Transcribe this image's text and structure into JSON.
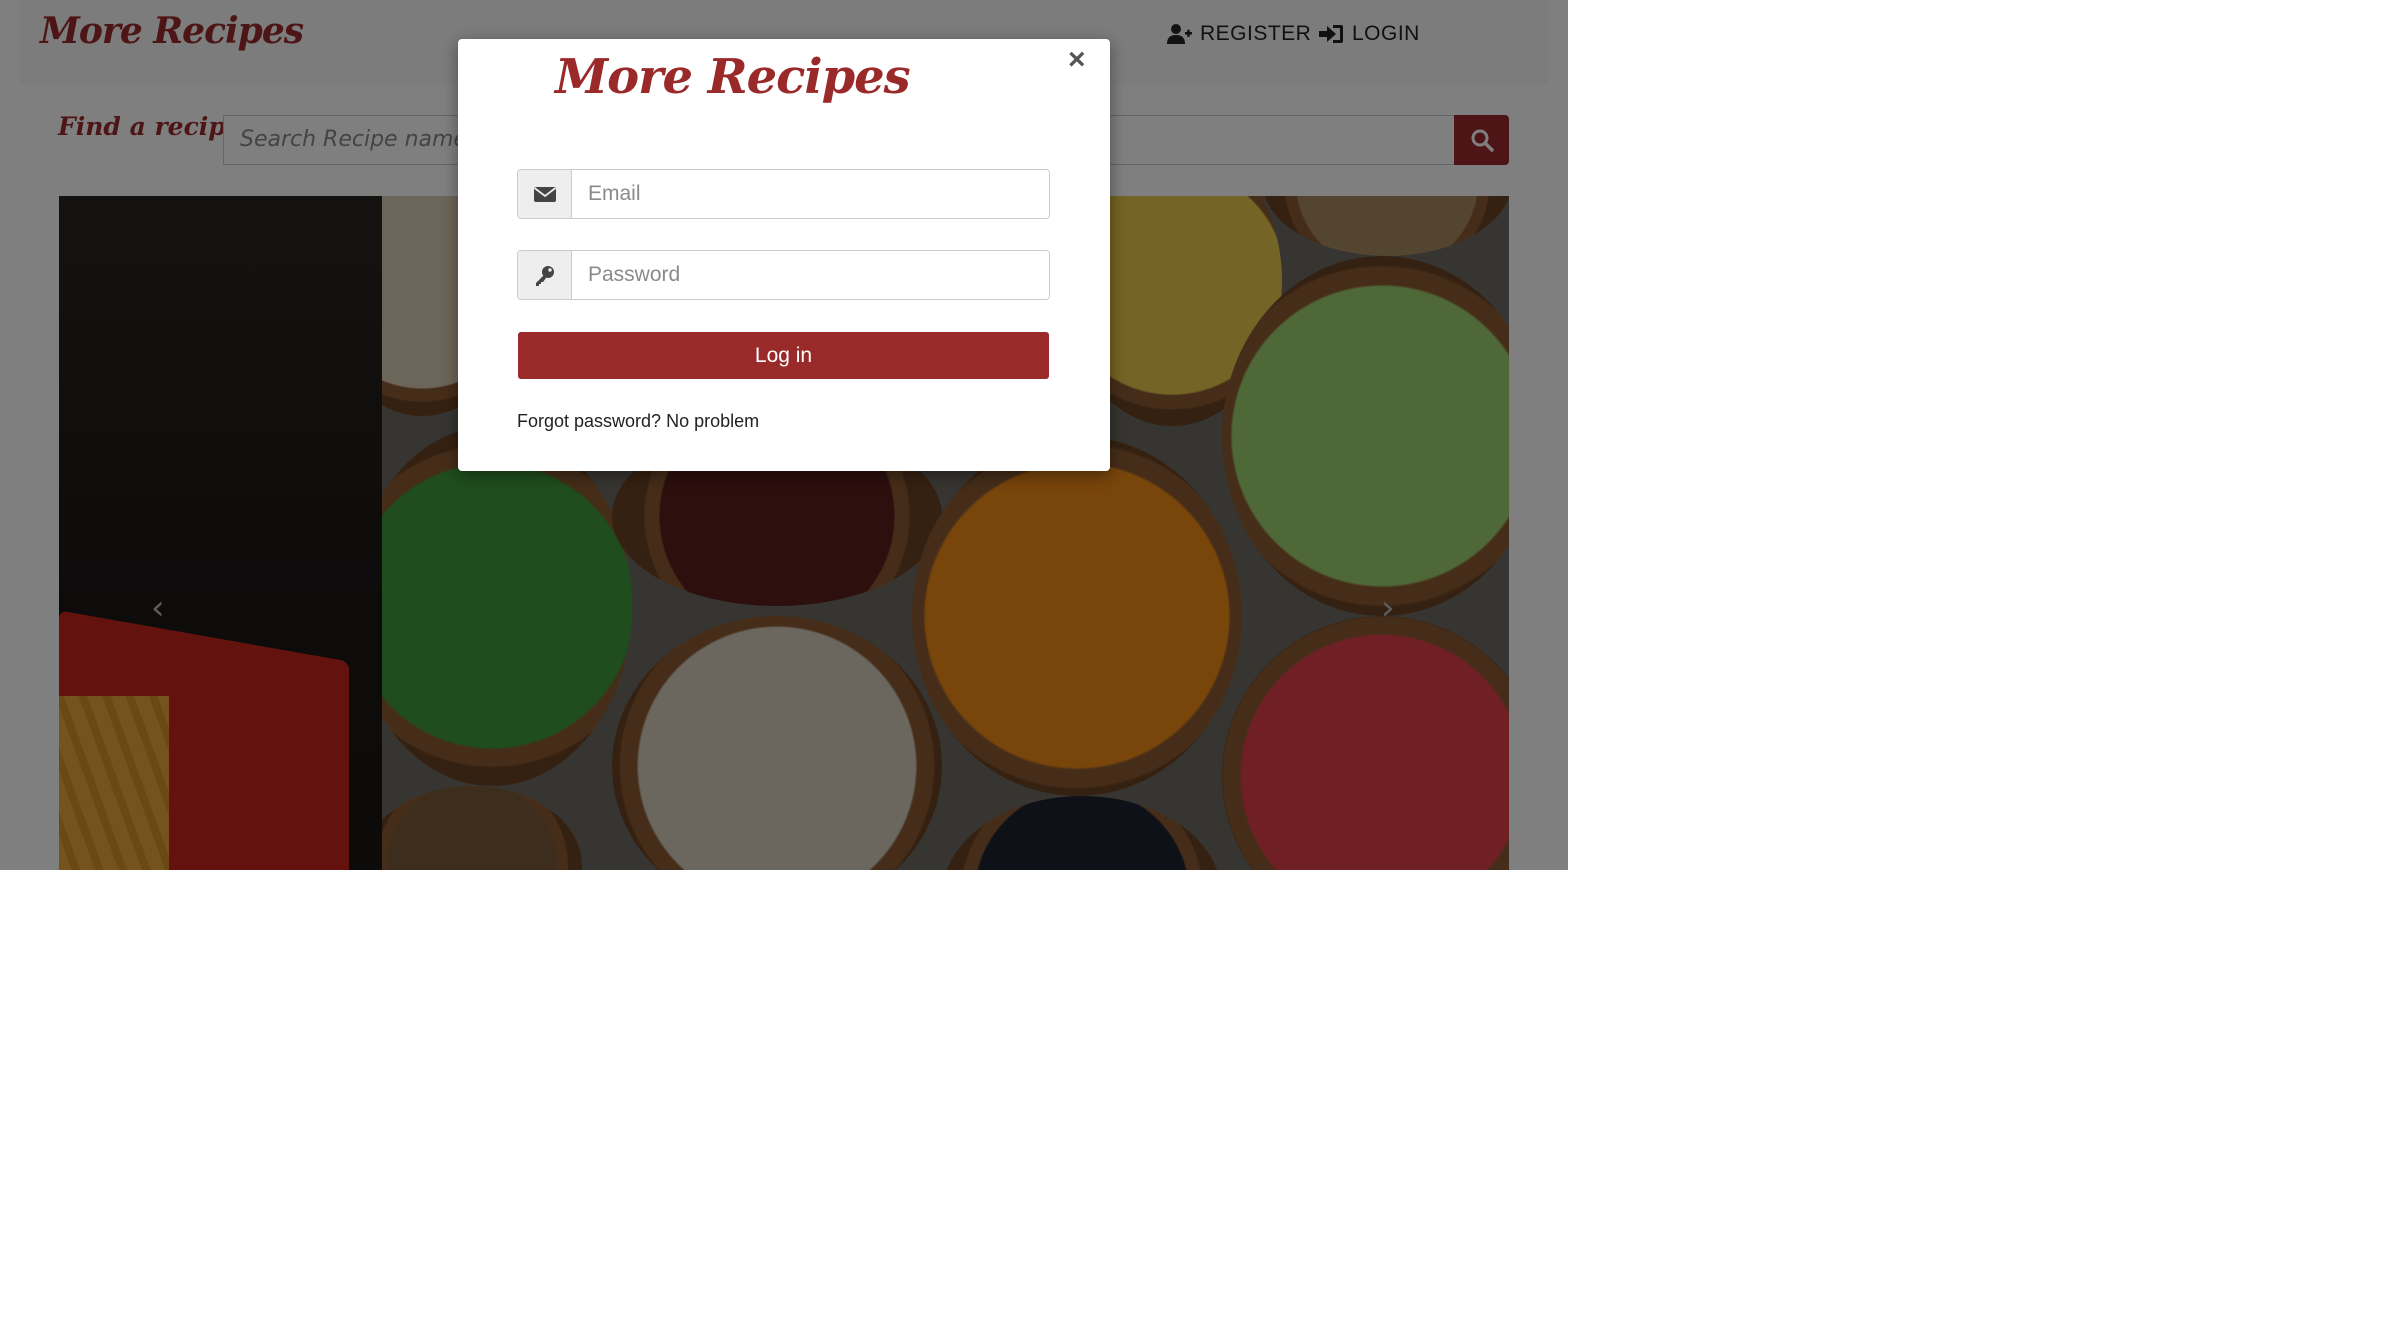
{
  "navbar": {
    "brand": "More Recipes",
    "register_label": "REGISTER",
    "login_label": "LOGIN",
    "register_icon": "user-plus-icon",
    "login_icon": "sign-in-icon"
  },
  "search": {
    "label": "Find a recipe:",
    "placeholder": "Search Recipe name or",
    "button_icon": "search-icon"
  },
  "carousel": {
    "prev_icon": "chevron-left-icon",
    "next_icon": "chevron-right-icon",
    "prev_glyph": "‹",
    "next_glyph": "›"
  },
  "modal": {
    "title": "More Recipes",
    "close_glyph": "×",
    "email_placeholder": "Email",
    "email_icon": "envelope-icon",
    "password_placeholder": "Password",
    "password_icon": "key-icon",
    "login_button": "Log in",
    "forgot_text": "Forgot password? No problem"
  },
  "colors": {
    "brand": "#9a2a2a",
    "backdrop": "rgba(0,0,0,0.5)"
  }
}
